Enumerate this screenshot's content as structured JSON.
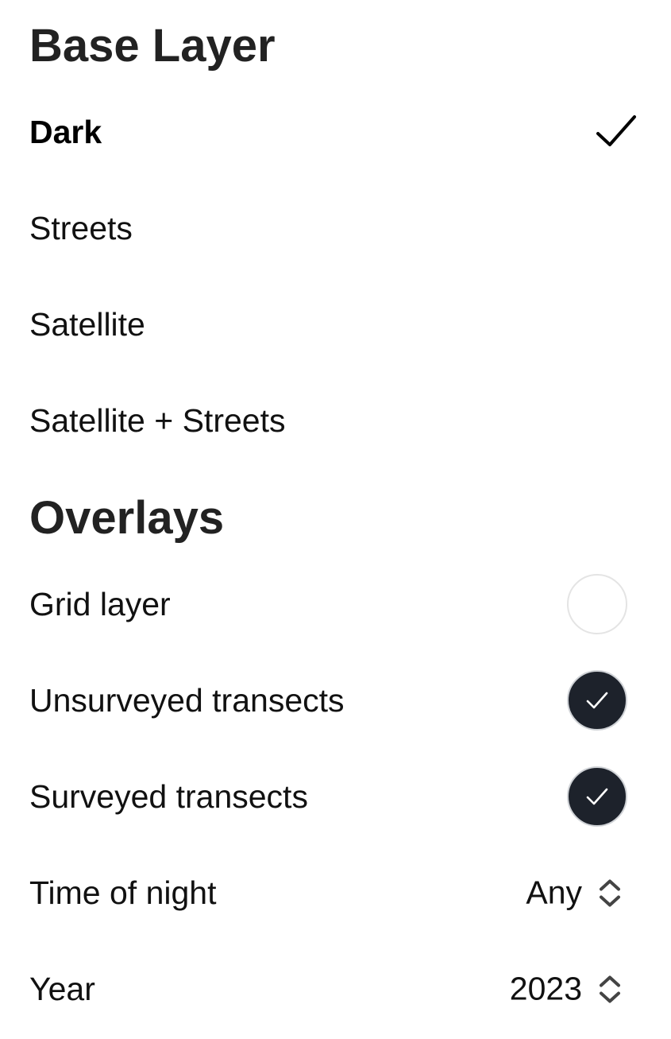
{
  "base_layer": {
    "title": "Base Layer",
    "options": [
      {
        "label": "Dark",
        "selected": true
      },
      {
        "label": "Streets",
        "selected": false
      },
      {
        "label": "Satellite",
        "selected": false
      },
      {
        "label": "Satellite + Streets",
        "selected": false
      }
    ],
    "selected_icon": "checkmark-icon"
  },
  "overlays": {
    "title": "Overlays",
    "toggles": [
      {
        "label": "Grid layer",
        "checked": false
      },
      {
        "label": "Unsurveyed transects",
        "checked": true
      },
      {
        "label": "Surveyed transects",
        "checked": true
      }
    ],
    "pickers": [
      {
        "label": "Time of night",
        "value": "Any",
        "icon": "chevron-up-down-icon"
      },
      {
        "label": "Year",
        "value": "2023",
        "icon": "chevron-up-down-icon"
      }
    ]
  },
  "colors": {
    "toggle_on": "#1d222b",
    "toggle_off": "#ffffff",
    "heading": "#222222"
  }
}
